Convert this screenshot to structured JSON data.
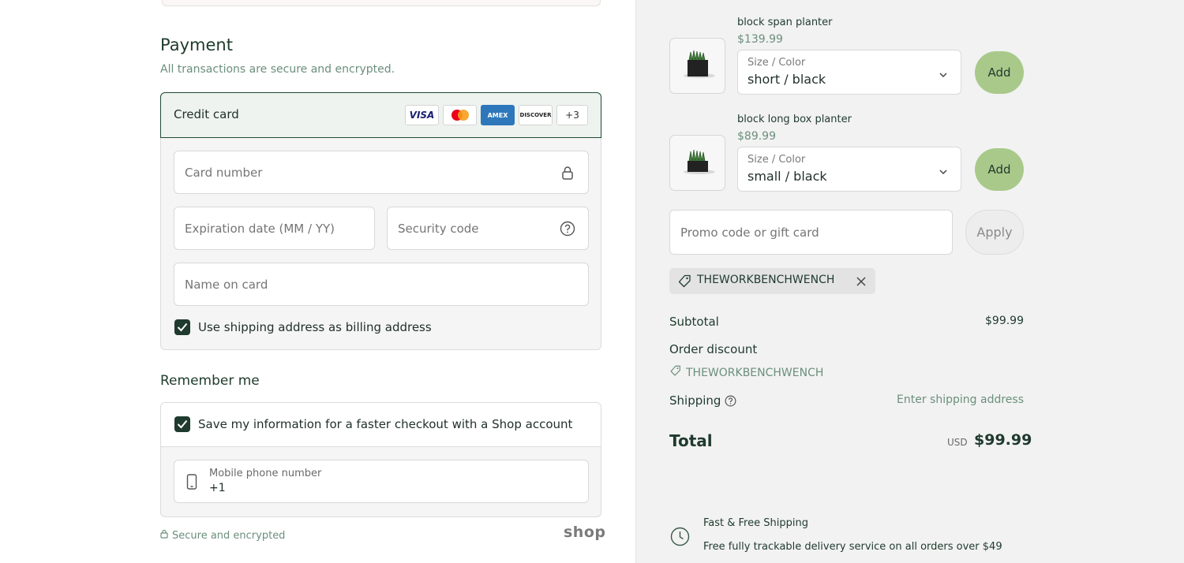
{
  "payment": {
    "title": "Payment",
    "subtitle": "All transactions are secure and encrypted.",
    "method_label": "Credit card",
    "card_brands": [
      "VISA",
      "Mastercard",
      "AMEX",
      "DISCOVER",
      "+3"
    ],
    "card_number_placeholder": "Card number",
    "expiration_placeholder": "Expiration date (MM / YY)",
    "security_code_placeholder": "Security code",
    "name_placeholder": "Name on card",
    "billing_checkbox_label": "Use shipping address as billing address",
    "billing_checked": true
  },
  "remember": {
    "title": "Remember me",
    "save_label": "Save my information for a faster checkout with a Shop account",
    "save_checked": true,
    "phone_label": "Mobile phone number",
    "phone_value": "+1"
  },
  "footer": {
    "secure_text": "Secure and encrypted",
    "shop_logo": "shop"
  },
  "products": [
    {
      "name": "block span planter",
      "price": "$139.99",
      "option_label": "Size / Color",
      "option_value": "short / black",
      "add_label": "Add"
    },
    {
      "name": "block long box planter",
      "price": "$89.99",
      "option_label": "Size / Color",
      "option_value": "small / black",
      "add_label": "Add"
    }
  ],
  "promo": {
    "placeholder": "Promo code or gift card",
    "apply_label": "Apply",
    "applied_code": "THEWORKBENCHWENCH"
  },
  "summary": {
    "subtotal_label": "Subtotal",
    "subtotal_value": "$99.99",
    "discount_label": "Order discount",
    "discount_code": "THEWORKBENCHWENCH",
    "shipping_label": "Shipping",
    "shipping_value": "Enter shipping address",
    "total_label": "Total",
    "currency": "USD",
    "total_value": "$99.99"
  },
  "shipping_promo": {
    "title": "Fast & Free Shipping",
    "text": "Free fully trackable delivery service on all orders over $49"
  },
  "colors": {
    "accent_dark": "#1f3a2e",
    "accent_muted": "#6b8f7d",
    "add_button": "#a9c98a"
  }
}
